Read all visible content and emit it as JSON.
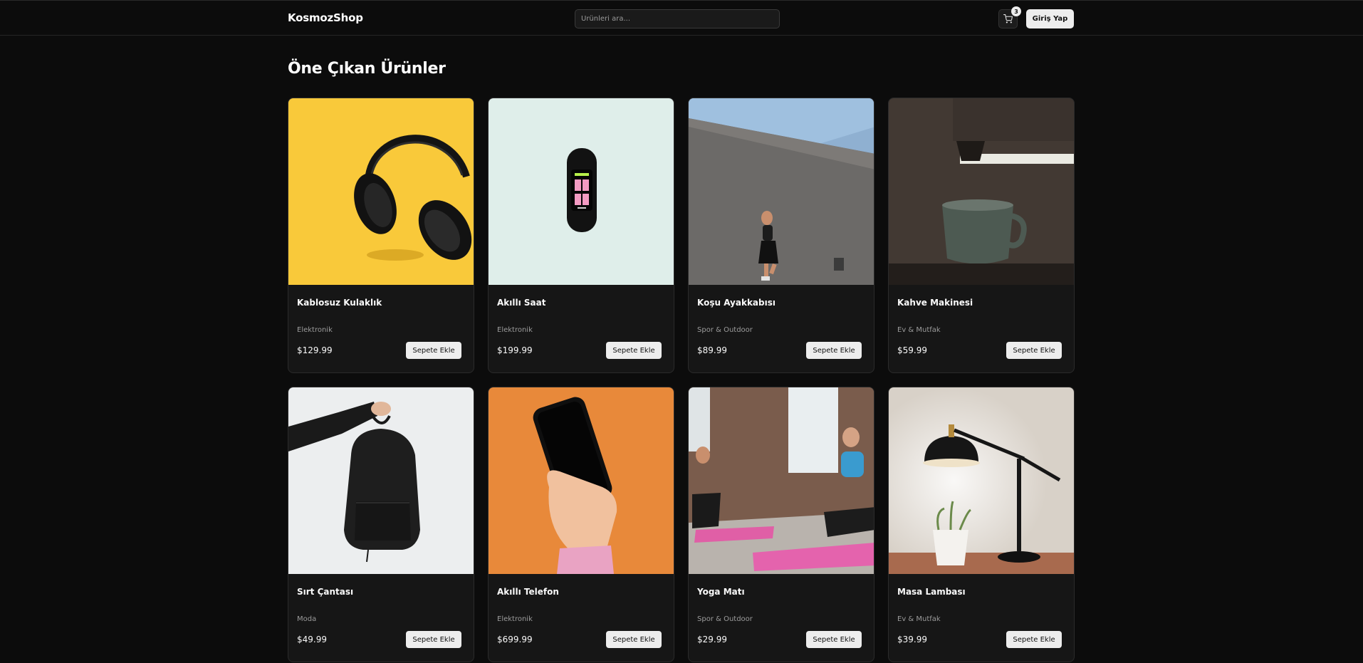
{
  "header": {
    "logo": "KosmozShop",
    "search_placeholder": "Ürünleri ara...",
    "cart_count": "3",
    "login_label": "Giriş Yap"
  },
  "main": {
    "title": "Öne Çıkan Ürünler",
    "add_label": "Sepete Ekle",
    "products": [
      {
        "name": "Kablosuz Kulaklık",
        "category": "Elektronik",
        "price": "$129.99",
        "image": "headphones-image"
      },
      {
        "name": "Akıllı Saat",
        "category": "Elektronik",
        "price": "$199.99",
        "image": "smartwatch-image"
      },
      {
        "name": "Koşu Ayakkabısı",
        "category": "Spor & Outdoor",
        "price": "$89.99",
        "image": "runner-image"
      },
      {
        "name": "Kahve Makinesi",
        "category": "Ev & Mutfak",
        "price": "$59.99",
        "image": "coffee-image"
      },
      {
        "name": "Sırt Çantası",
        "category": "Moda",
        "price": "$49.99",
        "image": "backpack-image"
      },
      {
        "name": "Akıllı Telefon",
        "category": "Elektronik",
        "price": "$699.99",
        "image": "phone-image"
      },
      {
        "name": "Yoga Matı",
        "category": "Spor & Outdoor",
        "price": "$29.99",
        "image": "yoga-image"
      },
      {
        "name": "Masa Lambası",
        "category": "Ev & Mutfak",
        "price": "$39.99",
        "image": "lamp-image"
      }
    ]
  },
  "colors": {
    "background": "#0c0c0c",
    "card": "#161616",
    "button": "#ededed"
  }
}
